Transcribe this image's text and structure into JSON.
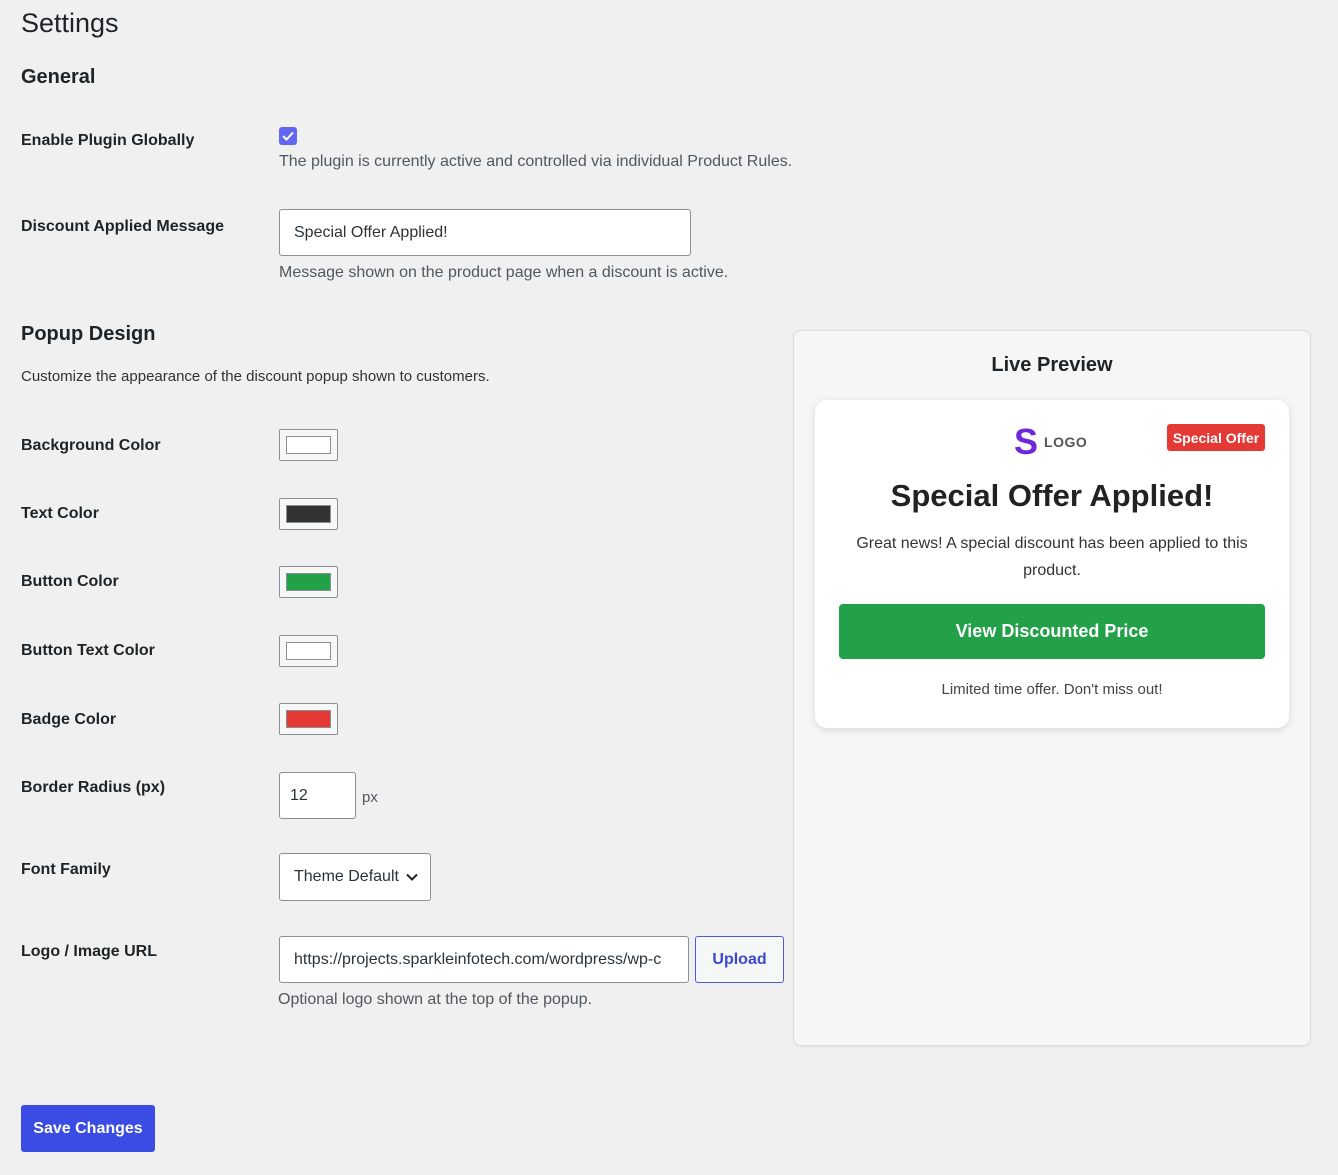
{
  "page": {
    "title": "Settings"
  },
  "general": {
    "heading": "General",
    "enable_plugin": {
      "label": "Enable Plugin Globally",
      "checked": true,
      "description": "The plugin is currently active and controlled via individual Product Rules."
    },
    "discount_message": {
      "label": "Discount Applied Message",
      "value": "Special Offer Applied!",
      "description": "Message shown on the product page when a discount is active."
    }
  },
  "popup_design": {
    "heading": "Popup Design",
    "description": "Customize the appearance of the discount popup shown to customers.",
    "colors": [
      {
        "label": "Background Color",
        "value": "#ffffff"
      },
      {
        "label": "Text Color",
        "value": "#333333"
      },
      {
        "label": "Button Color",
        "value": "#22a149"
      },
      {
        "label": "Button Text Color",
        "value": "#ffffff"
      },
      {
        "label": "Badge Color",
        "value": "#e53935"
      }
    ],
    "border_radius": {
      "label": "Border Radius (px)",
      "value": "12",
      "unit": "px"
    },
    "font_family": {
      "label": "Font Family",
      "selected": "Theme Default"
    },
    "logo_url": {
      "label": "Logo / Image URL",
      "value": "https://projects.sparkleinfotech.com/wordpress/wp-c",
      "upload_label": "Upload",
      "description": "Optional logo shown at the top of the popup."
    }
  },
  "save_button": {
    "label": "Save Changes"
  },
  "preview": {
    "title": "Live Preview",
    "logo_letter": "S",
    "logo_text": "LOGO",
    "badge": "Special Offer",
    "heading": "Special Offer Applied!",
    "body": "Great news! A special discount has been applied to this product.",
    "button": "View Discounted Price",
    "footer": "Limited time offer. Don't miss out!"
  },
  "icons": {
    "checkbox": "checkmark-icon",
    "select": "chevron-down-icon",
    "logo": "logo-s-icon"
  }
}
